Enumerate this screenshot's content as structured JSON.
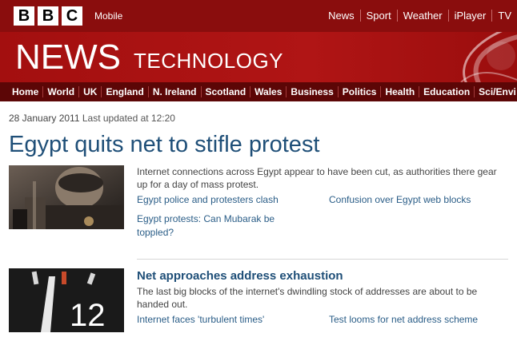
{
  "brand": {
    "logo_letters": [
      "B",
      "B",
      "C"
    ],
    "mobile": "Mobile"
  },
  "top_nav": [
    "News",
    "Sport",
    "Weather",
    "iPlayer",
    "TV"
  ],
  "masthead": {
    "title": "NEWS",
    "section": "TECHNOLOGY"
  },
  "section_nav": [
    "Home",
    "World",
    "UK",
    "England",
    "N. Ireland",
    "Scotland",
    "Wales",
    "Business",
    "Politics",
    "Health",
    "Education",
    "Sci/Envi"
  ],
  "article": {
    "date": "28 January 2011",
    "updated": "Last updated at 12:20",
    "headline": "Egypt quits net to stifle protest"
  },
  "stories": [
    {
      "summary": "Internet connections across Egypt appear to have been cut, as authorities there gear up for a day of mass protest.",
      "links": [
        "Egypt police and protesters clash",
        "Confusion over Egypt web blocks",
        "Egypt protests: Can Mubarak be toppled?"
      ]
    },
    {
      "title": "Net approaches address exhaustion",
      "summary": "The last big blocks of the internet's dwindling stock of addresses are about to be handed out.",
      "links": [
        "Internet faces 'turbulent times'",
        "Test looms for net address scheme"
      ],
      "thumb_text": "12"
    }
  ],
  "colors": {
    "topbar": "#8a0d0d",
    "masthead": "#b01515",
    "section_nav": "#5c0606",
    "headline": "#1f4f78",
    "link": "#2a5d87"
  }
}
